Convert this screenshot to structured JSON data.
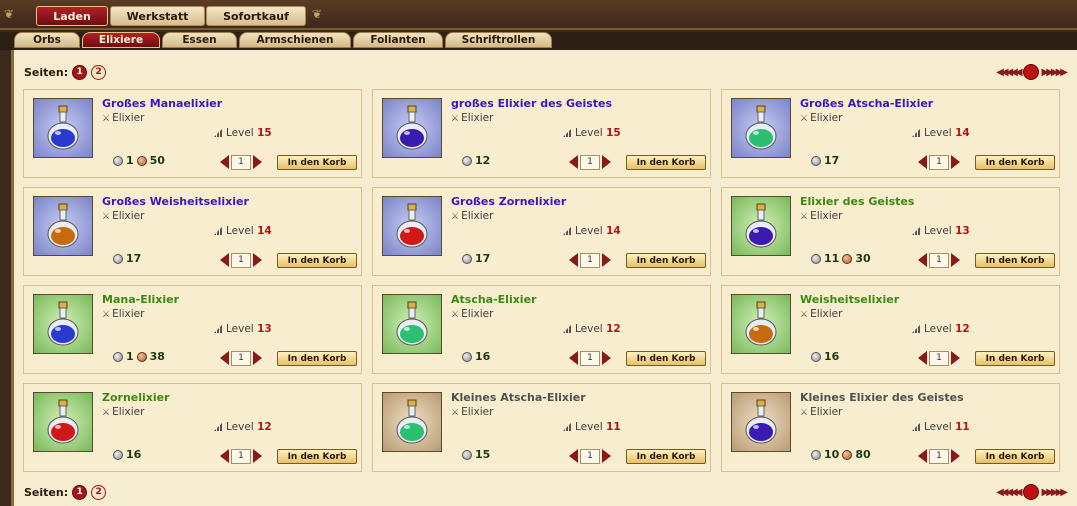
{
  "top_tabs": [
    {
      "label": "Laden",
      "active": true
    },
    {
      "label": "Werkstatt",
      "active": false
    },
    {
      "label": "Sofortkauf",
      "active": false
    }
  ],
  "sub_tabs": [
    {
      "label": "Orbs",
      "active": false
    },
    {
      "label": "Elixiere",
      "active": true
    },
    {
      "label": "Essen",
      "active": false
    },
    {
      "label": "Armschienen",
      "active": false
    },
    {
      "label": "Folianten",
      "active": false
    },
    {
      "label": "Schriftrollen",
      "active": false
    }
  ],
  "pager": {
    "label": "Seiten:",
    "pages": [
      "1",
      "2"
    ],
    "current": "1"
  },
  "level_label": "Level",
  "buy_label": "In den Korb",
  "items": [
    {
      "name": "Großes Manaelixier",
      "name_color": "blue",
      "type": "Elixier",
      "level": "15",
      "silver": "1",
      "copper": "50",
      "qty": "1",
      "bg": "blue",
      "icon": "blue-potion-icon",
      "potion_color": "#2a3ad0"
    },
    {
      "name": "großes Elixier des Geistes",
      "name_color": "blue",
      "type": "Elixier",
      "level": "15",
      "silver": "12",
      "copper": null,
      "qty": "1",
      "bg": "blue",
      "icon": "violet-potion-icon",
      "potion_color": "#3a1ab0"
    },
    {
      "name": "Großes Atscha-Elixier",
      "name_color": "blue",
      "type": "Elixier",
      "level": "14",
      "silver": "17",
      "copper": null,
      "qty": "1",
      "bg": "blue",
      "icon": "green-potion-icon",
      "potion_color": "#2ac070"
    },
    {
      "name": "Großes Weisheitselixier",
      "name_color": "blue",
      "type": "Elixier",
      "level": "14",
      "silver": "17",
      "copper": null,
      "qty": "1",
      "bg": "blue",
      "icon": "orange-potion-icon",
      "potion_color": "#c86a10"
    },
    {
      "name": "Großes Zornelixier",
      "name_color": "blue",
      "type": "Elixier",
      "level": "14",
      "silver": "17",
      "copper": null,
      "qty": "1",
      "bg": "blue",
      "icon": "red-potion-icon",
      "potion_color": "#d01818"
    },
    {
      "name": "Elixier des Geistes",
      "name_color": "green",
      "type": "Elixier",
      "level": "13",
      "silver": "11",
      "copper": "30",
      "qty": "1",
      "bg": "green",
      "icon": "violet-potion-icon",
      "potion_color": "#3a1ab0"
    },
    {
      "name": "Mana-Elixier",
      "name_color": "green",
      "type": "Elixier",
      "level": "13",
      "silver": "1",
      "copper": "38",
      "qty": "1",
      "bg": "green",
      "icon": "blue-potion-icon",
      "potion_color": "#2a3ad0"
    },
    {
      "name": "Atscha-Elixier",
      "name_color": "green",
      "type": "Elixier",
      "level": "12",
      "silver": "16",
      "copper": null,
      "qty": "1",
      "bg": "green",
      "icon": "green-potion-icon",
      "potion_color": "#2ac070"
    },
    {
      "name": "Weisheitselixier",
      "name_color": "green",
      "type": "Elixier",
      "level": "12",
      "silver": "16",
      "copper": null,
      "qty": "1",
      "bg": "green",
      "icon": "orange-potion-icon",
      "potion_color": "#c86a10"
    },
    {
      "name": "Zornelixier",
      "name_color": "green",
      "type": "Elixier",
      "level": "12",
      "silver": "16",
      "copper": null,
      "qty": "1",
      "bg": "green",
      "icon": "red-potion-icon",
      "potion_color": "#d01818"
    },
    {
      "name": "Kleines Atscha-Elixier",
      "name_color": "gray",
      "type": "Elixier",
      "level": "11",
      "silver": "15",
      "copper": null,
      "qty": "1",
      "bg": "brown",
      "icon": "green-potion-icon",
      "potion_color": "#2ac070"
    },
    {
      "name": "Kleines Elixier des Geistes",
      "name_color": "gray",
      "type": "Elixier",
      "level": "11",
      "silver": "10",
      "copper": "80",
      "qty": "1",
      "bg": "brown",
      "icon": "violet-potion-icon",
      "potion_color": "#3a1ab0"
    }
  ]
}
